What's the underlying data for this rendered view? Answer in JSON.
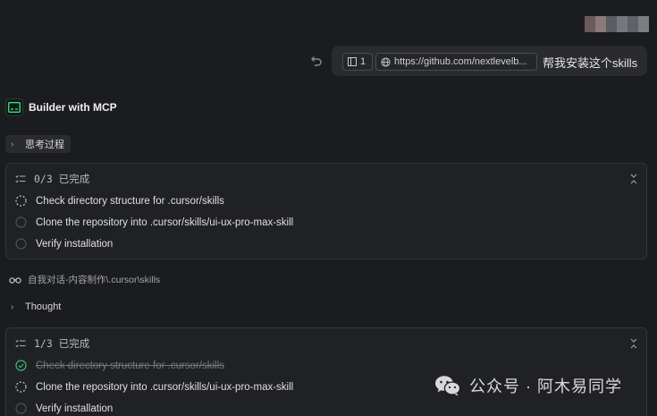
{
  "user_message": {
    "context_count": "1",
    "url_chip": "https://github.com/nextlevelb...",
    "text": "帮我安装这个skills"
  },
  "agent": {
    "name": "Builder with MCP"
  },
  "thinking": {
    "label": "思考过程"
  },
  "todo_lists": [
    {
      "status": "0/3 已完成",
      "items": [
        {
          "label": "Check directory structure for .cursor/skills",
          "state": "in-progress"
        },
        {
          "label": "Clone the repository into .cursor/skills/ui-ux-pro-max-skill",
          "state": "pending"
        },
        {
          "label": "Verify installation",
          "state": "pending"
        }
      ]
    },
    {
      "status": "1/3 已完成",
      "items": [
        {
          "label": "Check directory structure for .cursor/skills",
          "state": "done"
        },
        {
          "label": "Clone the repository into .cursor/skills/ui-ux-pro-max-skill",
          "state": "in-progress"
        },
        {
          "label": "Verify installation",
          "state": "pending"
        }
      ]
    }
  ],
  "workspace": {
    "path": "自我对话-内容制作\\.cursor\\skills"
  },
  "thought": {
    "label": "Thought"
  },
  "watermark": {
    "text": "公众号 · 阿木易同学"
  },
  "colors": {
    "background": "#1b1c1f",
    "card": "#202125",
    "done_green": "#3fb37a",
    "agent_icon_green": "#3ddc84"
  }
}
